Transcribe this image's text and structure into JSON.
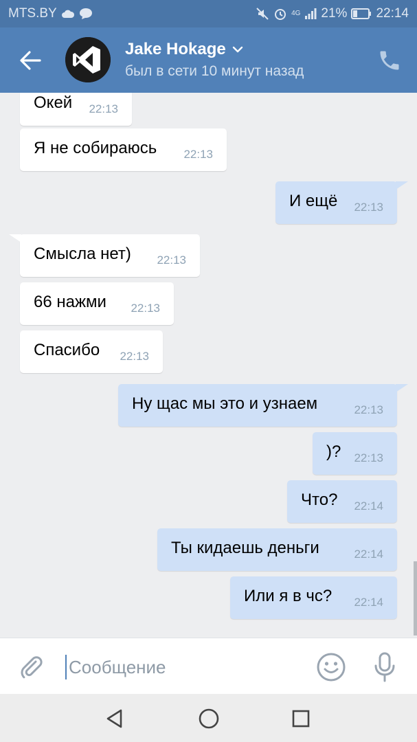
{
  "status_bar": {
    "carrier": "MTS.BY",
    "network": "4G",
    "battery": "21%",
    "time": "22:14"
  },
  "header": {
    "contact_name": "Jake Hokage",
    "contact_status": "был в сети 10 минут назад",
    "back_icon": "arrow-left-icon",
    "call_icon": "phone-icon"
  },
  "messages": [
    {
      "dir": "in",
      "text": "Окей",
      "time": "22:13"
    },
    {
      "dir": "in",
      "text": "Я не собираюсь",
      "time": "22:13"
    },
    {
      "dir": "out",
      "text": "И ещё",
      "time": "22:13"
    },
    {
      "dir": "in",
      "text": "Смысла нет)",
      "time": "22:13"
    },
    {
      "dir": "in",
      "text": "66 нажми",
      "time": "22:13"
    },
    {
      "dir": "in",
      "text": "Спасибо",
      "time": "22:13"
    },
    {
      "dir": "out",
      "text": "Ну щас мы это и узнаем",
      "time": "22:13"
    },
    {
      "dir": "out",
      "text": ")?",
      "time": "22:13"
    },
    {
      "dir": "out",
      "text": "Что?",
      "time": "22:14"
    },
    {
      "dir": "out",
      "text": "Ты кидаешь деньги",
      "time": "22:14"
    },
    {
      "dir": "out",
      "text": "Или я в чс?",
      "time": "22:14"
    }
  ],
  "input": {
    "placeholder": "Сообщение",
    "value": ""
  },
  "colors": {
    "header": "#5181b8",
    "status_bar": "#4a76a8",
    "incoming_bubble": "#ffffff",
    "outgoing_bubble": "#cfe0f7",
    "chat_background": "#edeef0"
  }
}
